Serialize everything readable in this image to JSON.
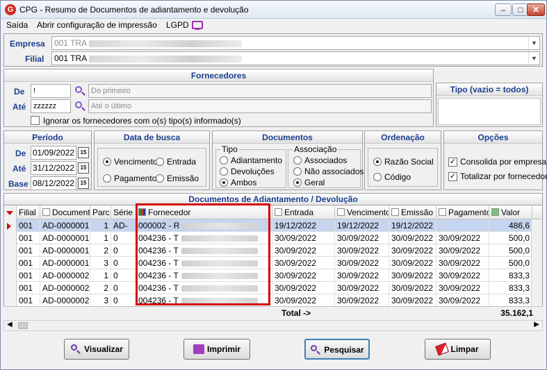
{
  "window": {
    "title": "CPG - Resumo de Documentos de adiantamento e devolução",
    "min": "–",
    "max": "□",
    "close": "✕"
  },
  "menu": {
    "saida": "Saída",
    "config": "Abrir configuração de impressão",
    "lgpd": "LGPD"
  },
  "empresa": {
    "label": "Empresa",
    "value": "001 TRA"
  },
  "filial": {
    "label": "Filial",
    "value": "001 TRA"
  },
  "fornecedores": {
    "title": "Fornecedores",
    "de_label": "De",
    "de_value": "!",
    "de_placeholder": "Do primeiro",
    "ate_label": "Até",
    "ate_value": "zzzzzz",
    "ate_placeholder": "Até o último",
    "ignore_label": "Ignorar os fornecedores com o(s) tipo(s) informado(s)"
  },
  "tipo": {
    "title": "Tipo (vazio = todos)"
  },
  "periodo": {
    "title": "Período",
    "de_label": "De",
    "de_value": "01/09/2022",
    "ate_label": "Até",
    "ate_value": "31/12/2022",
    "base_label": "Base",
    "base_value": "08/12/2022",
    "cal": "15"
  },
  "data_busca": {
    "title": "Data de busca",
    "vencimento": "Vencimento",
    "entrada": "Entrada",
    "pagamento": "Pagamento",
    "emissao": "Emissão"
  },
  "documentos": {
    "title": "Documentos",
    "tipo_title": "Tipo",
    "adiantamento": "Adiantamento",
    "devolucoes": "Devoluções",
    "ambos": "Ambos",
    "assoc_title": "Associação",
    "associados": "Associados",
    "nao_associados": "Não associados",
    "geral": "Geral"
  },
  "ordenacao": {
    "title": "Ordenação",
    "razao": "Razão Social",
    "codigo": "Código"
  },
  "opcoes": {
    "title": "Opções",
    "consolida": "Consolida por empresa",
    "totalizar": "Totalizar por fornecedor"
  },
  "grid": {
    "title": "Documentos de Adiantamento / Devolução",
    "headers": [
      "Filial",
      "Documento",
      "Parc",
      "Série",
      "Fornecedor",
      "Entrada",
      "Vencimento",
      "Emissão",
      "Pagamento",
      "Valor"
    ],
    "rows": [
      [
        "001",
        "AD-0000001",
        "1",
        "AD-",
        "000002 - R",
        "19/12/2022",
        "19/12/2022",
        "19/12/2022",
        "",
        "486,6"
      ],
      [
        "001",
        "AD-0000001",
        "1",
        "0",
        "004236 - T",
        "30/09/2022",
        "30/09/2022",
        "30/09/2022",
        "30/09/2022",
        "500,0"
      ],
      [
        "001",
        "AD-0000001",
        "2",
        "0",
        "004236 - T",
        "30/09/2022",
        "30/09/2022",
        "30/09/2022",
        "30/09/2022",
        "500,0"
      ],
      [
        "001",
        "AD-0000001",
        "3",
        "0",
        "004236 - T",
        "30/09/2022",
        "30/09/2022",
        "30/09/2022",
        "30/09/2022",
        "500,0"
      ],
      [
        "001",
        "AD-0000002",
        "1",
        "0",
        "004236 - T",
        "30/09/2022",
        "30/09/2022",
        "30/09/2022",
        "30/09/2022",
        "833,3"
      ],
      [
        "001",
        "AD-0000002",
        "2",
        "0",
        "004236 - T",
        "30/09/2022",
        "30/09/2022",
        "30/09/2022",
        "30/09/2022",
        "833,3"
      ],
      [
        "001",
        "AD-0000002",
        "3",
        "0",
        "004236 - T",
        "30/09/2022",
        "30/09/2022",
        "30/09/2022",
        "30/09/2022",
        "833,3"
      ]
    ],
    "total_label": "Total ->",
    "total_value": "35.162,1"
  },
  "buttons": {
    "visualizar": "Visualizar",
    "imprimir": "Imprimir",
    "pesquisar": "Pesquisar",
    "limpar": "Limpar"
  },
  "colors": {
    "accent": "#1b3f8f",
    "highlight": "#d40000",
    "selected_row": "#c5d5ef"
  }
}
